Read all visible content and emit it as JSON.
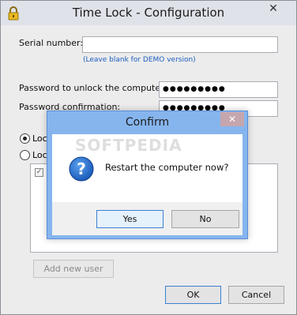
{
  "window": {
    "title": "Time Lock - Configuration",
    "close_glyph": "✕"
  },
  "form": {
    "serial_label": "Serial number:",
    "serial_value": "",
    "serial_hint": "(Leave blank for DEMO version)",
    "password_label": "Password to unlock the computer:",
    "password_value": "●●●●●●●●●",
    "confirm_label": "Password confirmation:",
    "confirm_value": "●●●●●●●●●",
    "radio1_label": "Lock",
    "radio2_label": "Lock",
    "radio1_checked": true,
    "radio2_checked": false
  },
  "buttons": {
    "add_user": "Add new user",
    "ok": "OK",
    "cancel": "Cancel"
  },
  "dialog": {
    "title": "Confirm",
    "close_glyph": "✕",
    "message": "Restart the computer now?",
    "yes": "Yes",
    "no": "No",
    "icon_glyph": "?"
  },
  "watermark": "SOFTPEDIA",
  "colors": {
    "dialog_border": "#86b5ee",
    "hint_text": "#1d5fbf",
    "close_hover": "#c6a6ad"
  }
}
